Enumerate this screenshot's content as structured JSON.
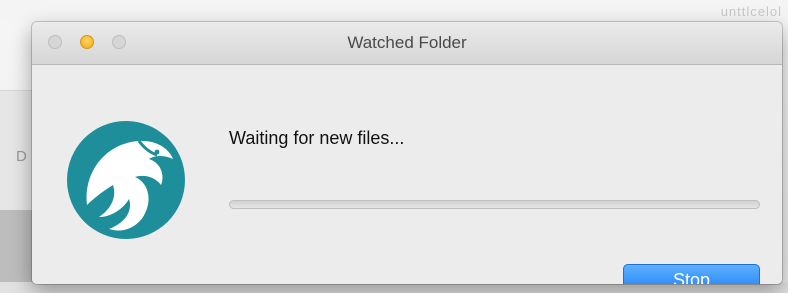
{
  "window": {
    "title": "Watched Folder"
  },
  "background_app": {
    "partial_text_right": "unttlcelol",
    "partial_letter_left": "D"
  },
  "dialog": {
    "status_text": "Waiting for new files...",
    "progress": {
      "fraction": 0
    },
    "stop_button_label": "Stop"
  },
  "icons": {
    "close": "close-traffic-light-icon",
    "minimize": "minimize-traffic-light-icon",
    "zoom": "zoom-traffic-light-icon",
    "app_logo": "bird-logo-icon"
  },
  "colors": {
    "logo_teal": "#1d8e9a",
    "button_blue": "#1a7cf5",
    "minimize_yellow": "#f5b325",
    "window_bg": "#ececec"
  }
}
